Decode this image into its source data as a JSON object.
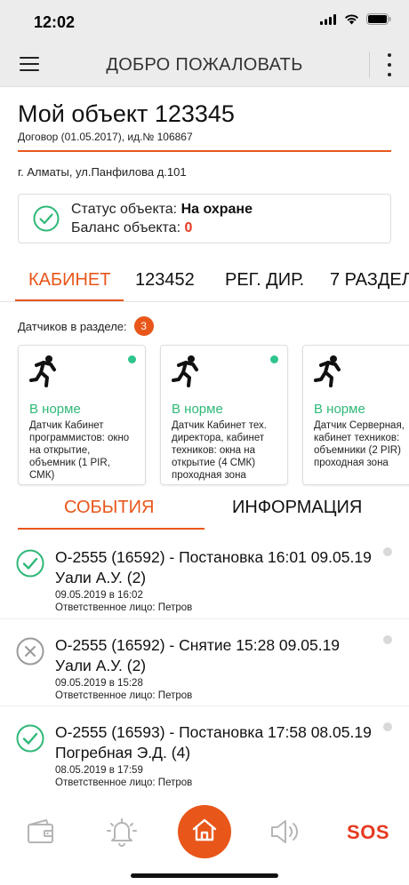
{
  "status_bar": {
    "time": "12:02"
  },
  "header": {
    "title": "ДОБРО ПОЖАЛОВАТЬ"
  },
  "object": {
    "title": "Мой объект 123345",
    "contract": "Договор  (01.05.2017), ид.№ 106867",
    "address": "г. Алматы, ул.Панфилова д.101"
  },
  "status_card": {
    "status_label": "Статус объекта: ",
    "status_value": "На охране",
    "balance_label": "Баланс объекта: ",
    "balance_value": "0"
  },
  "tabs": [
    {
      "label": "КАБИНЕТ",
      "active": true
    },
    {
      "label": "123452"
    },
    {
      "label": "РЕГ. ДИР."
    },
    {
      "label": "7 РАЗДЕЛ"
    }
  ],
  "sensors": {
    "caption": "Датчиков в разделе:",
    "count": "3",
    "items": [
      {
        "state": "В норме",
        "description": "Датчик  Кабинет программистов: окно на открытие, объемник  (1 PIR, СМК)",
        "online": true
      },
      {
        "state": "В норме",
        "description": "Датчик  Кабинет тех. директора, кабинет техников: окна на открытие  (4 СМК) проходная зона",
        "online": true
      },
      {
        "state": "В норме",
        "description": "Датчик  Серверная, кабинет техников: объемники  (2 PIR) проходная зона",
        "online": true
      }
    ]
  },
  "sub_tabs": [
    {
      "label": "СОБЫТИЯ",
      "active": true
    },
    {
      "label": "ИНФОРМАЦИЯ"
    }
  ],
  "events": [
    {
      "title": "О-2555 (16592) - Постановка 16:01 09.05.19 Уали А.У. (2)",
      "date": "09.05.2019 в 16:02",
      "person": "Ответственное лицо: Петров",
      "type": "check"
    },
    {
      "title": "О-2555 (16592) - Снятие 15:28 09.05.19 Уали А.У. (2)",
      "date": "09.05.2019 в 15:28",
      "person": "Ответственное лицо: Петров",
      "type": "cross"
    },
    {
      "title": "О-2555 (16593) - Постановка 17:58 08.05.19 Погребная Э.Д. (4)",
      "date": "08.05.2019 в 17:59",
      "person": "Ответственное лицо: Петров",
      "type": "check"
    }
  ],
  "bottom_nav": {
    "sos_label": "SOS"
  },
  "colors": {
    "accent": "#e8561a",
    "ok": "#2fb878",
    "alert": "#e53a20"
  }
}
